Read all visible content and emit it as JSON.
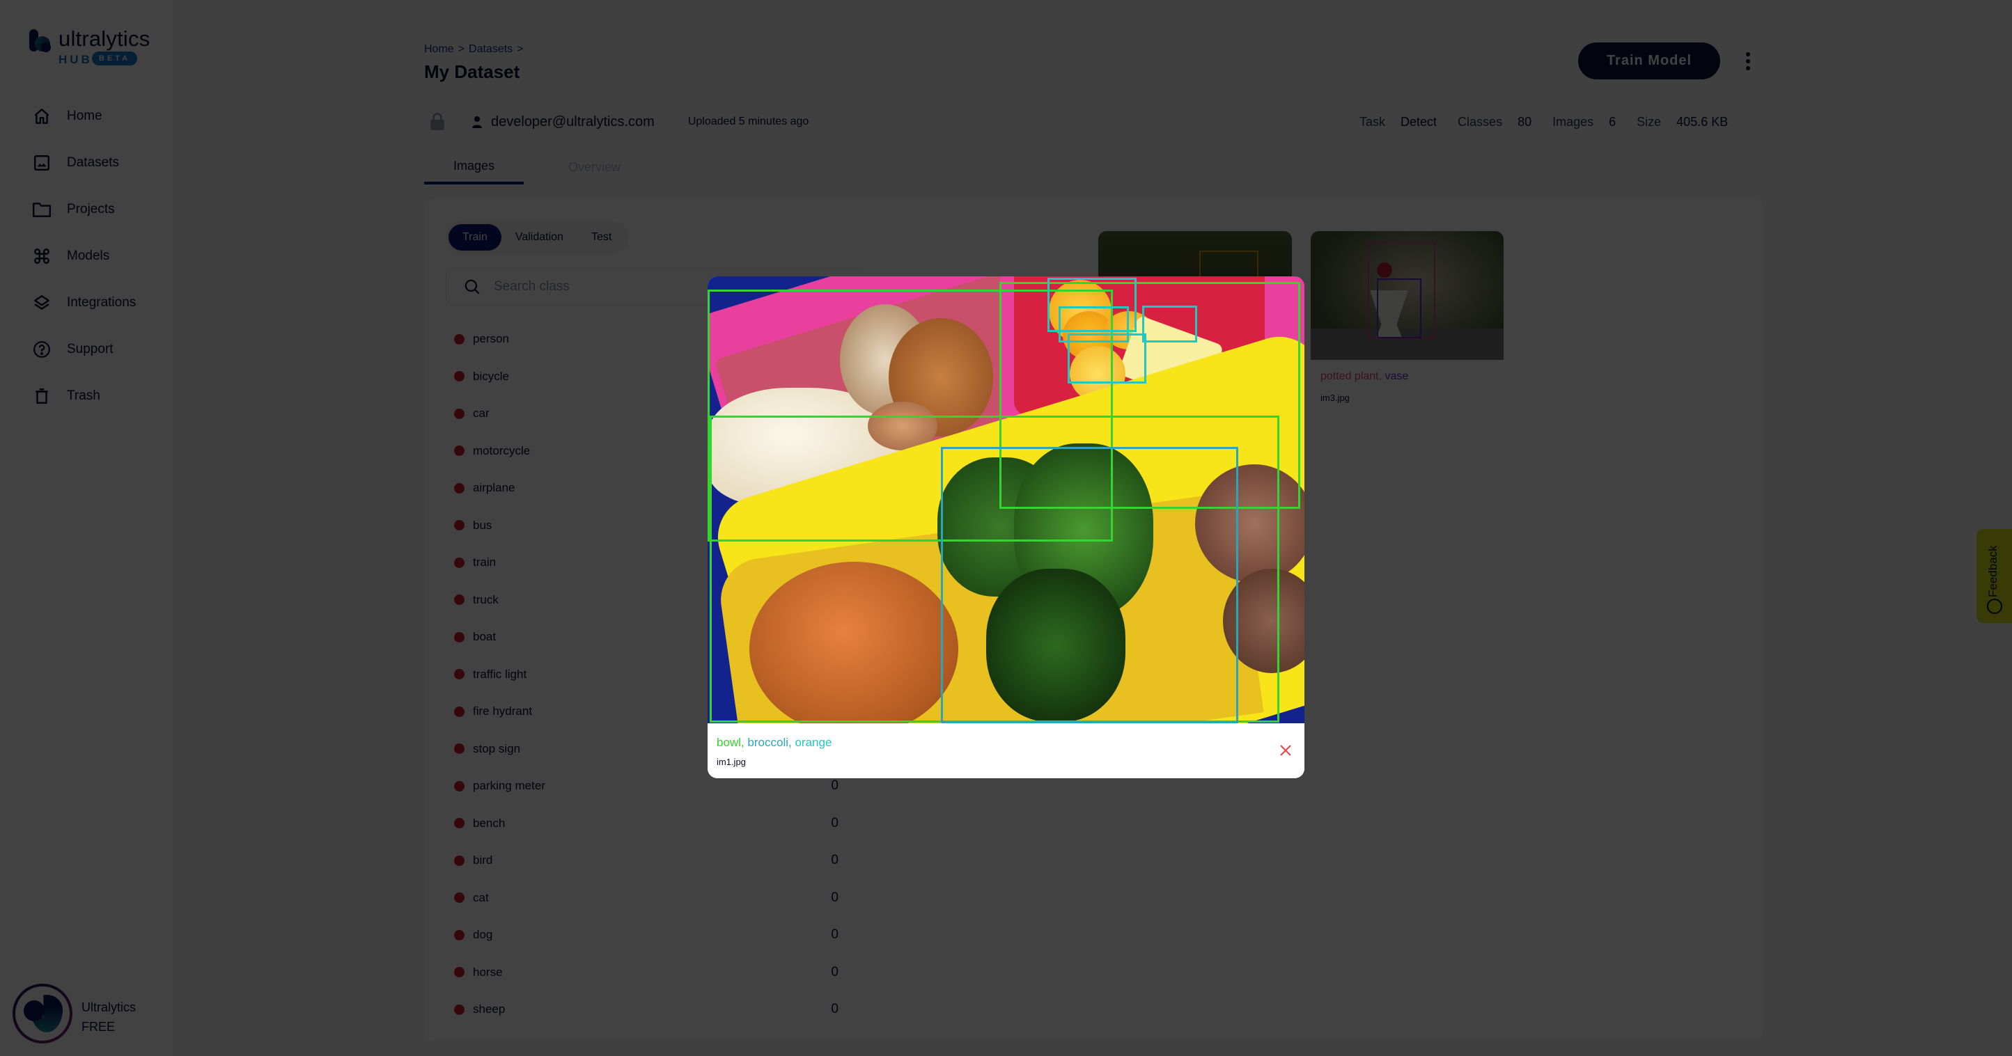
{
  "app": {
    "brand": "ultralytics",
    "brand_sub": "HUB",
    "brand_badge": "BETA"
  },
  "sidebar": {
    "items": [
      {
        "label": "Home",
        "icon": "home-icon"
      },
      {
        "label": "Datasets",
        "icon": "image-icon"
      },
      {
        "label": "Projects",
        "icon": "folder-icon"
      },
      {
        "label": "Models",
        "icon": "command-icon"
      },
      {
        "label": "Integrations",
        "icon": "layers-icon"
      },
      {
        "label": "Support",
        "icon": "help-circle-icon"
      },
      {
        "label": "Trash",
        "icon": "trash-icon"
      }
    ],
    "user": {
      "name": "Ultralytics",
      "plan": "FREE"
    }
  },
  "header": {
    "breadcrumb": [
      {
        "label": "Home"
      },
      {
        "label": "Datasets"
      }
    ],
    "breadcrumb_sep": ">",
    "title": "My Dataset",
    "train_button": "Train Model",
    "owner": "developer@ultralytics.com",
    "uploaded": "Uploaded 5 minutes ago",
    "stats": [
      {
        "key": "Task",
        "value": "Detect"
      },
      {
        "key": "Classes",
        "value": "80"
      },
      {
        "key": "Images",
        "value": "6"
      },
      {
        "key": "Size",
        "value": "405.6 KB"
      }
    ]
  },
  "tabs": [
    {
      "label": "Images",
      "active": true
    },
    {
      "label": "Overview",
      "active": false
    }
  ],
  "splits": [
    {
      "label": "Train",
      "active": true
    },
    {
      "label": "Validation",
      "active": false
    },
    {
      "label": "Test",
      "active": false
    }
  ],
  "search": {
    "placeholder": "Search class",
    "value": ""
  },
  "class_color": "#d11f2c",
  "classes": [
    {
      "name": "person",
      "count": ""
    },
    {
      "name": "bicycle",
      "count": ""
    },
    {
      "name": "car",
      "count": ""
    },
    {
      "name": "motorcycle",
      "count": ""
    },
    {
      "name": "airplane",
      "count": ""
    },
    {
      "name": "bus",
      "count": ""
    },
    {
      "name": "train",
      "count": ""
    },
    {
      "name": "truck",
      "count": ""
    },
    {
      "name": "boat",
      "count": ""
    },
    {
      "name": "traffic light",
      "count": ""
    },
    {
      "name": "fire hydrant",
      "count": ""
    },
    {
      "name": "stop sign",
      "count": ""
    },
    {
      "name": "parking meter",
      "count": "0"
    },
    {
      "name": "bench",
      "count": "0"
    },
    {
      "name": "bird",
      "count": "0"
    },
    {
      "name": "cat",
      "count": "0"
    },
    {
      "name": "dog",
      "count": "0"
    },
    {
      "name": "horse",
      "count": "0"
    },
    {
      "name": "sheep",
      "count": "0"
    }
  ],
  "thumbnails": [
    {
      "labels": [],
      "file": ""
    },
    {
      "labels": [
        {
          "text": "potted plant",
          "color": "#e0487a"
        },
        {
          "text": "vase",
          "color": "#5b2bd6"
        }
      ],
      "file": "im3.jpg"
    }
  ],
  "modal": {
    "labels": [
      {
        "text": "bowl",
        "color": "#35d430"
      },
      {
        "text": "broccoli",
        "color": "#2aa6b8"
      },
      {
        "text": "orange",
        "color": "#23c7c0"
      }
    ],
    "file": "im1.jpg",
    "box_colors": {
      "bowl": "#35d430",
      "broccoli": "#2aa6b8",
      "orange": "#23c7c0"
    }
  },
  "feedback": {
    "label": "Feedback"
  }
}
